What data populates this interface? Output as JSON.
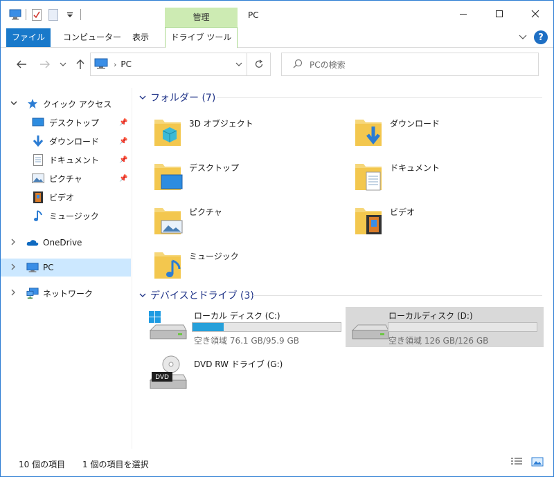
{
  "window": {
    "title": "PC",
    "context_tab_header": "管理"
  },
  "ribbon": {
    "tabs": [
      "ファイル",
      "コンピューター",
      "表示",
      "ドライブ ツール"
    ],
    "help": "?"
  },
  "address_bar": {
    "crumb": "PC",
    "search_placeholder": "PCの検索"
  },
  "nav": {
    "quick_access": {
      "label": "クイック アクセス",
      "items": [
        {
          "label": "デスクトップ",
          "icon": "desktop-icon",
          "pinned": true
        },
        {
          "label": "ダウンロード",
          "icon": "download-icon",
          "pinned": true
        },
        {
          "label": "ドキュメント",
          "icon": "document-icon",
          "pinned": true
        },
        {
          "label": "ピクチャ",
          "icon": "picture-icon",
          "pinned": true
        },
        {
          "label": "ビデオ",
          "icon": "video-icon",
          "pinned": false
        },
        {
          "label": "ミュージック",
          "icon": "music-icon",
          "pinned": false
        }
      ]
    },
    "onedrive": "OneDrive",
    "pc": "PC",
    "network": "ネットワーク"
  },
  "content": {
    "folders_header": "フォルダー (7)",
    "folders": [
      {
        "label": "3D オブジェクト",
        "icon": "3d-objects-folder-icon"
      },
      {
        "label": "ダウンロード",
        "icon": "downloads-folder-icon"
      },
      {
        "label": "デスクトップ",
        "icon": "desktop-folder-icon"
      },
      {
        "label": "ドキュメント",
        "icon": "documents-folder-icon"
      },
      {
        "label": "ピクチャ",
        "icon": "pictures-folder-icon"
      },
      {
        "label": "ビデオ",
        "icon": "videos-folder-icon"
      },
      {
        "label": "ミュージック",
        "icon": "music-folder-icon"
      }
    ],
    "devices_header": "デバイスとドライブ (3)",
    "drives": [
      {
        "label": "ローカル ディスク (C:)",
        "info": "空き領域 76.1 GB/95.9 GB",
        "used_fraction": 0.21,
        "icon": "windows-drive-icon"
      },
      {
        "label": "ローカルディスク (D:)",
        "info": "空き領域 126 GB/126 GB",
        "used_fraction": 0.0,
        "icon": "hard-drive-icon"
      },
      {
        "label": "DVD RW ドライブ (G:)",
        "icon": "dvd-drive-icon",
        "badge": "DVD"
      }
    ]
  },
  "status": {
    "item_count": "10 個の項目",
    "selected": "1 個の項目を選択"
  },
  "colors": {
    "accent": "#1979ca",
    "selected_bg": "#cce8ff",
    "drive_bar": "#26a0da",
    "group_header": "#1e3287",
    "context_tab": "#cdebb3"
  }
}
